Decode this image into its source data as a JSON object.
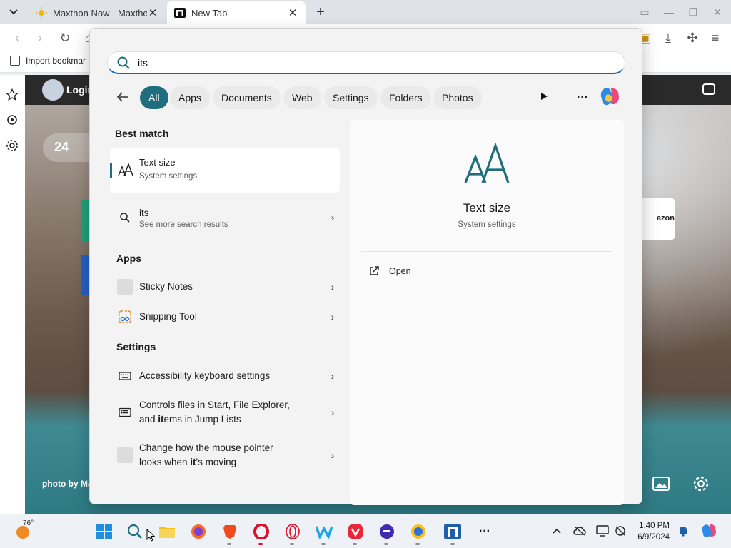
{
  "browser": {
    "tabs": [
      {
        "label": "Maxthon Now - Maxtho",
        "favicon": "sun-icon"
      },
      {
        "label": "New Tab",
        "favicon": "maxthon-icon",
        "active": true
      }
    ],
    "bookmarks": [
      {
        "label": "Import bookmar"
      }
    ]
  },
  "page": {
    "login_label": "Login",
    "weather_temp": "24",
    "amazon_text": "azon",
    "photo_by": "photo by Ma"
  },
  "search": {
    "query": "its",
    "filters": [
      "All",
      "Apps",
      "Documents",
      "Web",
      "Settings",
      "Folders",
      "Photos"
    ],
    "active_filter": "All",
    "more_label": "···",
    "best_match_header": "Best match",
    "best_match": {
      "title": "Text size",
      "subtitle": "System settings"
    },
    "web_result": {
      "title": "its",
      "subtitle": "See more search results"
    },
    "apps_header": "Apps",
    "apps": [
      {
        "title": "Sticky Notes"
      },
      {
        "title": "Snipping Tool"
      }
    ],
    "settings_header": "Settings",
    "settings": [
      {
        "title": "Accessibility keyboard settings"
      },
      {
        "title_line1": "Controls files in Start, File Explorer,",
        "title_line2_pre": "and ",
        "title_line2_bold": "it",
        "title_line2_post": "ems in Jump Lists"
      },
      {
        "title_line1": "Change how the mouse pointer",
        "title_line2_pre": "looks when ",
        "title_line2_bold": "it",
        "title_line2_post": "'s moving"
      }
    ],
    "preview": {
      "title": "Text size",
      "subtitle": "System settings",
      "action": "Open"
    }
  },
  "taskbar": {
    "temperature": "76°",
    "time": "1:40 PM",
    "date": "6/9/2024"
  },
  "colors": {
    "accent": "#1f6e7e",
    "search_underline": "#0067c0"
  }
}
